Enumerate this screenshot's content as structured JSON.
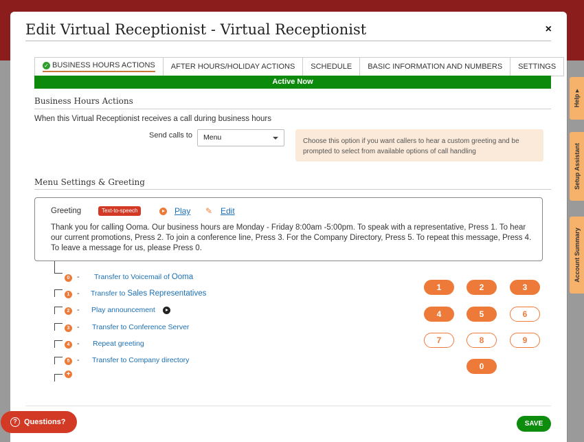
{
  "modal": {
    "title": "Edit Virtual Receptionist - Virtual Receptionist",
    "close": "×"
  },
  "tabs": [
    {
      "label": "BUSINESS HOURS ACTIONS",
      "active": true
    },
    {
      "label": "AFTER HOURS/HOLIDAY ACTIONS"
    },
    {
      "label": "SCHEDULE"
    },
    {
      "label": "BASIC INFORMATION AND NUMBERS"
    },
    {
      "label": "SETTINGS"
    }
  ],
  "status": {
    "active_label": "Active Now",
    "color": "#0b8a0b"
  },
  "business_hours": {
    "heading": "Business Hours Actions",
    "description": "When this Virtual Receptionist receives a call during business hours",
    "send_calls_label": "Send calls to",
    "send_calls_value": "Menu",
    "hint": "Choose this option if you want callers to hear a custom greeting and be prompted to select from available options of call handling"
  },
  "menu": {
    "heading": "Menu Settings & Greeting",
    "greeting_label": "Greeting",
    "tts_badge": "Text-to-speech",
    "play": "Play",
    "edit": "Edit",
    "greeting_text": "Thank you for calling Ooma. Our business hours are Monday - Friday 8:00am -5:00pm. To speak with a representative, Press 1. To hear our current promotions, Press 2. To join a conference line, Press 3. For the Company Directory, Press 5. To repeat this message, Press 4. To leave a message for us, please Press 0.",
    "options": [
      {
        "num": "0",
        "text_a": "Transfer to Voicemail of",
        "text_b": "Ooma"
      },
      {
        "num": "1",
        "text_a": "Transfer to",
        "text_b": "Sales Representatives"
      },
      {
        "num": "2",
        "text_a": "Play announcement",
        "text_b": ""
      },
      {
        "num": "3",
        "text_a": "Transfer to Conference Server",
        "text_b": ""
      },
      {
        "num": "4",
        "text_a": "Repeat greeting",
        "text_b": ""
      },
      {
        "num": "5",
        "text_a": "Transfer to Company directory",
        "text_b": ""
      }
    ],
    "add_icon": "+"
  },
  "keypad": [
    {
      "label": "1",
      "assigned": true
    },
    {
      "label": "2",
      "assigned": true
    },
    {
      "label": "3",
      "assigned": true
    },
    {
      "label": "4",
      "assigned": true
    },
    {
      "label": "5",
      "assigned": true
    },
    {
      "label": "6",
      "assigned": false
    },
    {
      "label": "7",
      "assigned": false
    },
    {
      "label": "8",
      "assigned": false
    },
    {
      "label": "9",
      "assigned": false
    },
    {
      "label": "0",
      "assigned": true
    }
  ],
  "footer": {
    "save": "SAVE",
    "questions": "Questions?"
  },
  "side_tabs": {
    "help": "Help ▸",
    "setup": "Setup Assistant",
    "account": "Account Summary"
  },
  "colors": {
    "accent": "#ee7a3a",
    "link": "#1b6fb3",
    "brand_red": "#8c1d1d",
    "save_green": "#0d8c0d"
  }
}
